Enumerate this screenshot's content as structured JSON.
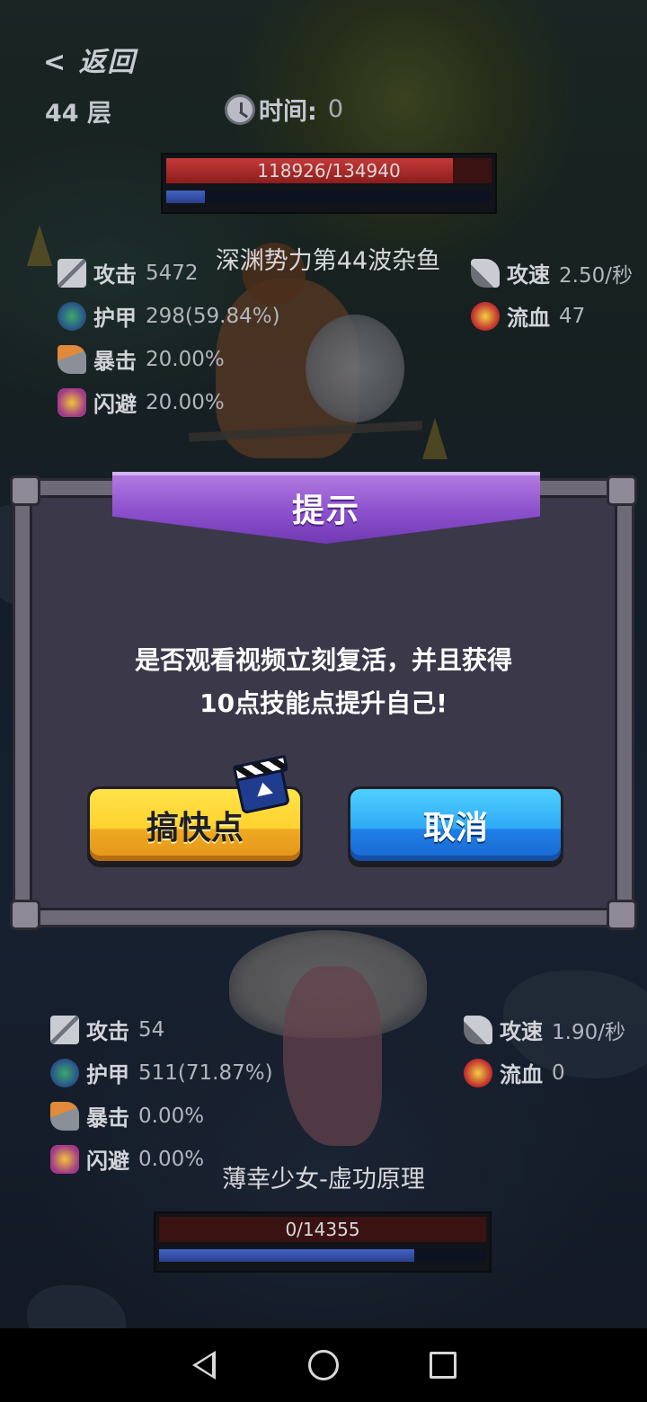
{
  "topbar": {
    "back_label": "< 返回",
    "floor_label": "44 层",
    "timer_label": "时间:",
    "timer_value": "0"
  },
  "enemy": {
    "hp_text": "118926/134940",
    "hp_fraction": 0.881,
    "mp_fraction": 0.12,
    "name": "深渊势力第44波杂鱼",
    "stats": {
      "attack_label": "攻击",
      "attack_value": "5472",
      "armor_label": "护甲",
      "armor_value": "298(59.84%)",
      "crit_label": "暴击",
      "crit_value": "20.00%",
      "dodge_label": "闪避",
      "dodge_value": "20.00%",
      "speed_label": "攻速",
      "speed_value": "2.50/秒",
      "bleed_label": "流血",
      "bleed_value": "47"
    }
  },
  "player": {
    "name": "薄幸少女-虚功原理",
    "hp_text": "0/14355",
    "hp_fraction": 0.0,
    "mp_fraction": 0.78,
    "stats": {
      "attack_label": "攻击",
      "attack_value": "54",
      "armor_label": "护甲",
      "armor_value": "511(71.87%)",
      "crit_label": "暴击",
      "crit_value": "0.00%",
      "dodge_label": "闪避",
      "dodge_value": "0.00%",
      "speed_label": "攻速",
      "speed_value": "1.90/秒",
      "bleed_label": "流血",
      "bleed_value": "0"
    }
  },
  "dialog": {
    "title": "提示",
    "message_line1": "是否观看视频立刻复活，并且获得",
    "message_line2": "10点技能点提升自己!",
    "confirm_label": "搞快点",
    "cancel_label": "取消"
  },
  "colors": {
    "hp_red": "#c23a38",
    "mp_blue": "#4262c4",
    "dialog_purple": "#8b4fcc",
    "btn_yellow": "#ffd22e",
    "btn_blue": "#2ea9f5"
  },
  "icons": {
    "attack": "crossed-swords-icon",
    "armor": "armor-orb-icon",
    "crit": "crit-axe-icon",
    "dodge": "dodge-lightning-icon",
    "speed": "attack-speed-sword-icon",
    "bleed": "bleed-icon",
    "timer": "stopwatch-icon",
    "video": "video-clapper-icon"
  }
}
